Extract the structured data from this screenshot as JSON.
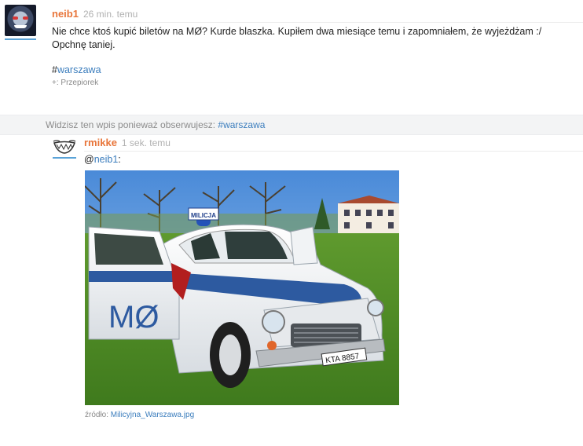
{
  "post": {
    "username": "neib1",
    "time": "26 min. temu",
    "text_line1": "Nie chce ktoś kupić biletów na MØ? Kurde blaszka. Kupiłem dwa miesiące temu i zapomniałem, że wyjeżdżam :/",
    "text_line2": "Opchnę taniej.",
    "tag_hash": "#",
    "tag": "warszawa",
    "vote_prefix": "+:",
    "vote_user": "Przepiorek"
  },
  "notice": {
    "text": "Widzisz ten wpis ponieważ obserwujesz: ",
    "tag": "#warszawa"
  },
  "reply": {
    "username": "rmikke",
    "time": "1 sek. temu",
    "mention_at": "@",
    "mention_user": "neib1",
    "mention_colon": ":",
    "image": {
      "badge_text": "MILICJA",
      "door_text": "MØ",
      "plate": "KTA 8857"
    },
    "source_label": "źródło:",
    "source_file": "Milicyjna_Warszawa.jpg"
  },
  "colors": {
    "username": "#e8753a",
    "link": "#3b7dbd",
    "notice_bg": "#f3f4f5",
    "car_stripe": "#2d5aa0"
  }
}
